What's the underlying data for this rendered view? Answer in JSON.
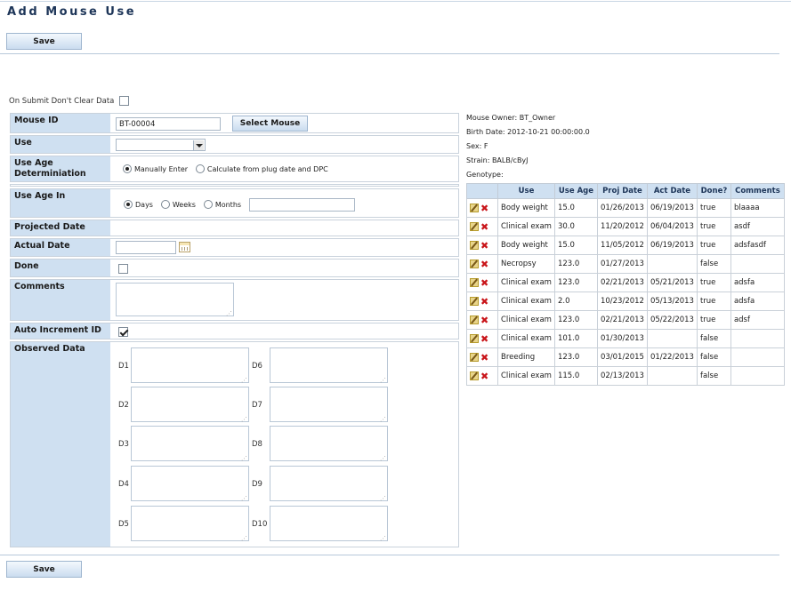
{
  "page": {
    "title": "Add Mouse Use"
  },
  "toolbar": {
    "save_label": "Save"
  },
  "submit_option": {
    "label": "On Submit Don't Clear Data",
    "checked": false
  },
  "form": {
    "mouse_id": {
      "label": "Mouse ID",
      "value": "BT-00004",
      "button": "Select Mouse"
    },
    "use": {
      "label": "Use",
      "value": ""
    },
    "use_age_determination": {
      "label": "Use Age Determiniation",
      "option_manual": "Manually Enter",
      "option_calc": "Calculate from plug date and DPC"
    },
    "use_age_in": {
      "label": "Use Age In",
      "days": "Days",
      "weeks": "Weeks",
      "months": "Months",
      "value": ""
    },
    "projected_date": {
      "label": "Projected Date"
    },
    "actual_date": {
      "label": "Actual Date",
      "value": ""
    },
    "done": {
      "label": "Done"
    },
    "comments": {
      "label": "Comments",
      "value": ""
    },
    "auto_increment": {
      "label": "Auto Increment ID"
    },
    "observed_data": {
      "label": "Observed Data",
      "fields": [
        "D1",
        "D2",
        "D3",
        "D4",
        "D5",
        "D6",
        "D7",
        "D8",
        "D9",
        "D10"
      ]
    }
  },
  "mouse_info": {
    "owner": "Mouse Owner: BT_Owner",
    "birth_date": "Birth Date: 2012-10-21 00:00:00.0",
    "sex": "Sex: F",
    "strain": "Strain: BALB/cByJ",
    "genotype": "Genotype:"
  },
  "uses_table": {
    "headers": [
      "",
      "Use",
      "Use Age",
      "Proj Date",
      "Act Date",
      "Done?",
      "Comments"
    ],
    "rows": [
      [
        "Body weight",
        "15.0",
        "01/26/2013",
        "06/19/2013",
        "true",
        "blaaaa"
      ],
      [
        "Clinical exam",
        "30.0",
        "11/20/2012",
        "06/04/2013",
        "true",
        "asdf"
      ],
      [
        "Body weight",
        "15.0",
        "11/05/2012",
        "06/19/2013",
        "true",
        "adsfasdf"
      ],
      [
        "Necropsy",
        "123.0",
        "01/27/2013",
        "",
        "false",
        ""
      ],
      [
        "Clinical exam",
        "123.0",
        "02/21/2013",
        "05/21/2013",
        "true",
        "adsfa"
      ],
      [
        "Clinical exam",
        "2.0",
        "10/23/2012",
        "05/13/2013",
        "true",
        "adsfa"
      ],
      [
        "Clinical exam",
        "123.0",
        "02/21/2013",
        "05/22/2013",
        "true",
        "adsf"
      ],
      [
        "Clinical exam",
        "101.0",
        "01/30/2013",
        "",
        "false",
        ""
      ],
      [
        "Breeding",
        "123.0",
        "03/01/2015",
        "01/22/2013",
        "false",
        ""
      ],
      [
        "Clinical exam",
        "115.0",
        "02/13/2013",
        "",
        "false",
        ""
      ]
    ]
  },
  "icons": {
    "edit": "edit-pencil-icon",
    "delete": "delete-x-icon",
    "calendar": "calendar-icon"
  }
}
